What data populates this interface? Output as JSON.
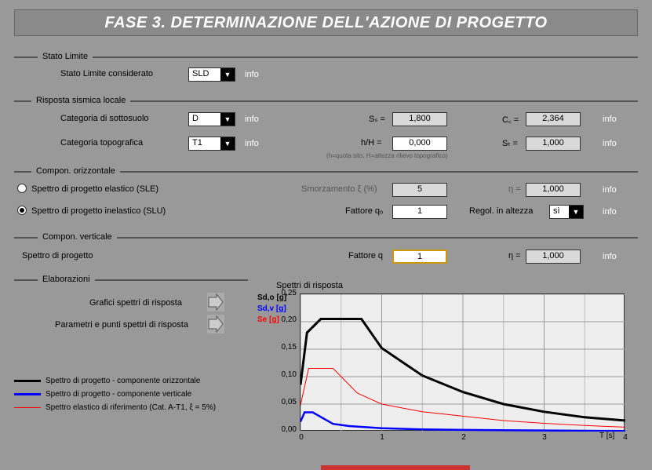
{
  "title": "FASE 3. DETERMINAZIONE DELL'AZIONE DI PROGETTO",
  "info": "info",
  "statoLimite": {
    "tab": "Stato Limite",
    "label": "Stato Limite considerato",
    "value": "SLD"
  },
  "risposta": {
    "tab": "Risposta sismica locale",
    "cat_sottosuolo_label": "Categoria di sottosuolo",
    "cat_sottosuolo": "D",
    "cat_topo_label": "Categoria topografica",
    "cat_topo": "T1",
    "ss_label": "Sₛ =",
    "ss": "1,800",
    "cc_label": "C꜀ =",
    "cc": "2,364",
    "hH_label": "h/H =",
    "hH": "0,000",
    "st_label": "Sₜ =",
    "st": "1,000",
    "note": "(h=quota sito, H=altezza rilievo topografico)"
  },
  "oriz": {
    "tab": "Compon. orizzontale",
    "opt1": "Spettro di progetto elastico (SLE)",
    "opt2": "Spettro di progetto inelastico (SLU)",
    "smorz_label": "Smorzamento  ξ (%) ",
    "smorz": "5",
    "eta_label": "η =",
    "eta": "1,000",
    "q_label": "Fattore qₒ",
    "q": "1",
    "reg_label": "Regol. in altezza",
    "reg": "sì"
  },
  "vert": {
    "tab": "Compon. verticale",
    "label": "Spettro di progetto",
    "q_label": "Fattore q",
    "q": "1",
    "eta_label": "η =",
    "eta": "1,000"
  },
  "elab": {
    "tab": "Elaborazioni",
    "btn1": "Grafici spettri di risposta",
    "btn2": "Parametri e punti spettri di risposta"
  },
  "legend": {
    "l1": "Spettro di progetto - componente orizzontale",
    "l2": "Spettro di progetto - componente verticale",
    "l3": "Spettro elastico di riferimento (Cat. A-T1, ξ = 5%)"
  },
  "chart_data": {
    "type": "line",
    "title": "Spettri di risposta",
    "xlabel": "T [s]",
    "xlim": [
      0,
      4
    ],
    "ylim": [
      0,
      0.25
    ],
    "yticks": [
      0.0,
      0.05,
      0.1,
      0.15,
      0.2,
      0.25
    ],
    "xticks": [
      0,
      1,
      2,
      3,
      4
    ],
    "xminor": 0.5,
    "series_labels": [
      "Sd,o [g]",
      "Sd,v [g]",
      "Se [g]"
    ],
    "series_colors": [
      "#000000",
      "#0000ff",
      "#ff0000"
    ],
    "series": [
      {
        "name": "Sd,o",
        "x": [
          0,
          0.08,
          0.25,
          0.75,
          1.0,
          1.5,
          2.0,
          2.5,
          3.0,
          3.5,
          4.0
        ],
        "values": [
          0.085,
          0.18,
          0.205,
          0.205,
          0.152,
          0.102,
          0.072,
          0.05,
          0.036,
          0.026,
          0.02
        ]
      },
      {
        "name": "Sd,v",
        "x": [
          0,
          0.05,
          0.15,
          0.4,
          0.6,
          1.0,
          1.5,
          2.0,
          3.0,
          4.0
        ],
        "values": [
          0.018,
          0.035,
          0.035,
          0.014,
          0.01,
          0.006,
          0.004,
          0.003,
          0.002,
          0.001
        ]
      },
      {
        "name": "Se",
        "x": [
          0,
          0.1,
          0.4,
          0.7,
          1.0,
          1.5,
          2.0,
          2.5,
          3.0,
          3.5,
          4.0
        ],
        "values": [
          0.048,
          0.115,
          0.115,
          0.07,
          0.05,
          0.036,
          0.028,
          0.02,
          0.015,
          0.011,
          0.008
        ]
      }
    ]
  }
}
